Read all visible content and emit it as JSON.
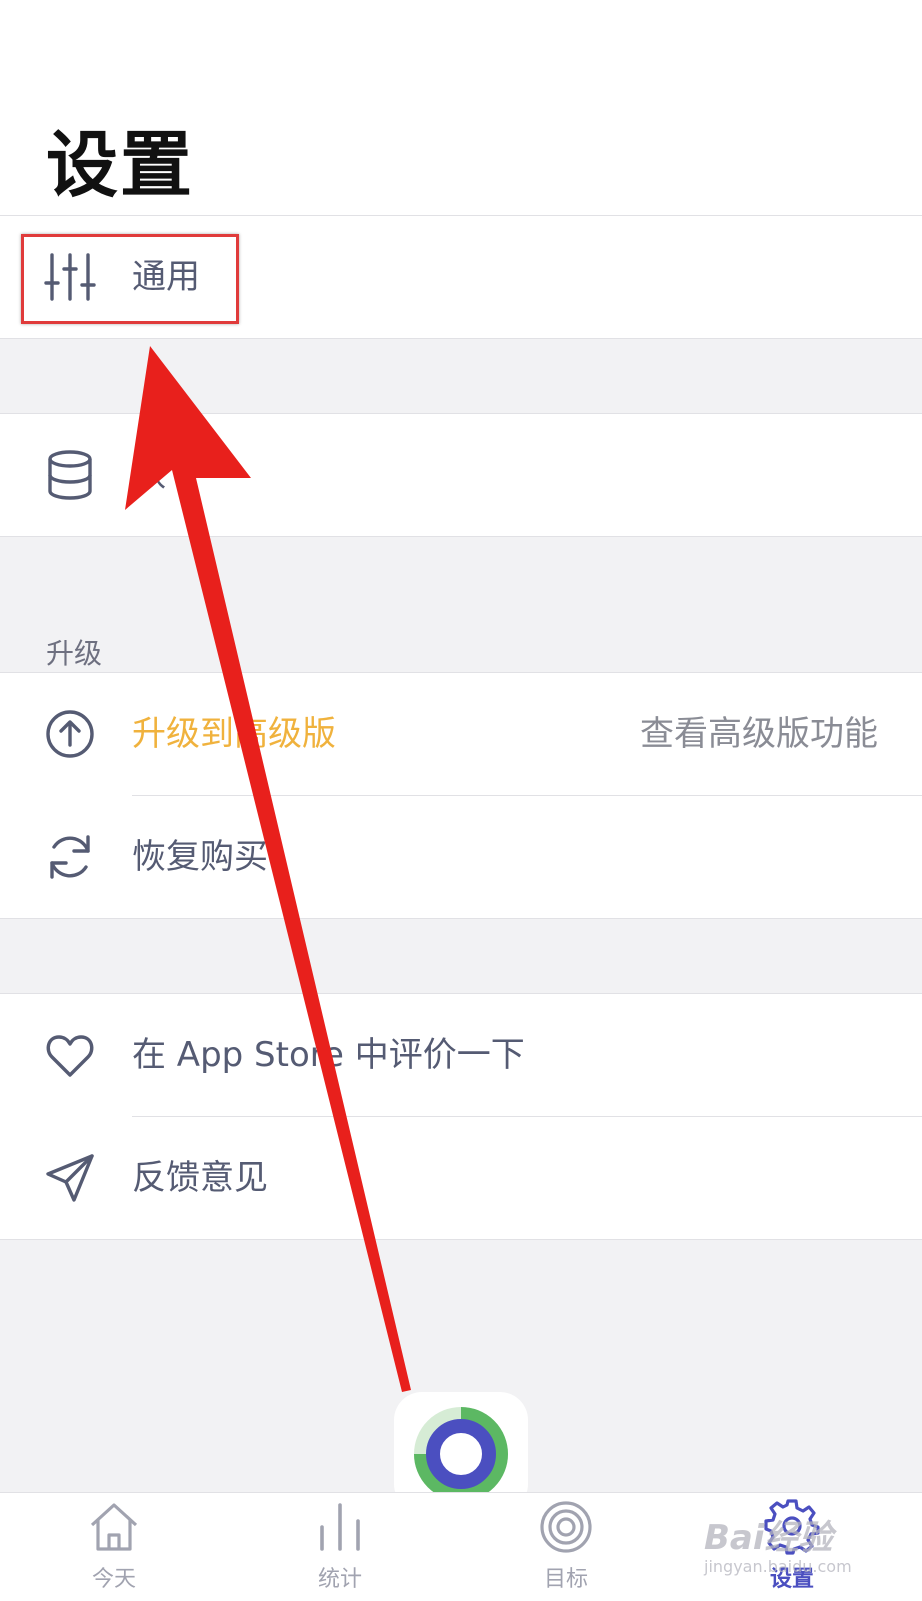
{
  "page": {
    "title": "设置"
  },
  "general_group": {
    "general_label": "通用"
  },
  "data_group": {
    "data_label": "数"
  },
  "upgrade_section": {
    "header": "升级",
    "upgrade_label": "升级到高级版",
    "upgrade_detail": "查看高级版功能",
    "restore_label": "恢复购买"
  },
  "feedback_group": {
    "rate_label": "在 App Store 中评价一下",
    "feedback_label": "反馈意见"
  },
  "tabbar": {
    "today": "今天",
    "stats": "统计",
    "goals": "目标",
    "settings": "设置",
    "active_tab": "settings"
  },
  "colors": {
    "accent_upgrade": "#f0b23d",
    "active_tab": "#4b4fc0",
    "annotation": "#e8201c"
  },
  "watermark": {
    "brand": "Bai经验",
    "url": "jingyan.baidu.com"
  }
}
